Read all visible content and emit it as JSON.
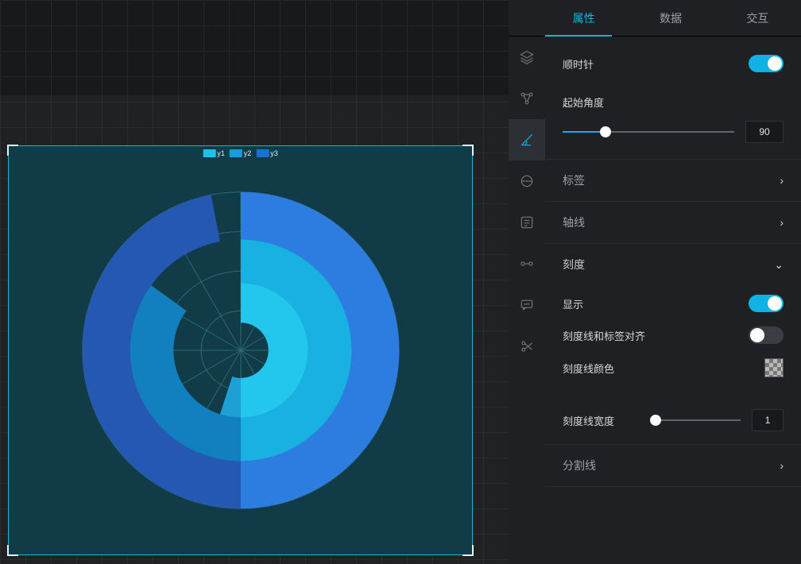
{
  "tabs": {
    "properties": "属性",
    "data": "数据",
    "interaction": "交互"
  },
  "iconbar": {
    "layers": "layers-icon",
    "nodes": "nodes-icon",
    "angle": "angle-icon",
    "circle": "circle-icon",
    "form": "form-icon",
    "link": "link-icon",
    "chat": "chat-icon",
    "scissors": "scissors-icon"
  },
  "settings": {
    "clockwise": {
      "label": "顺时针",
      "value": true
    },
    "start_angle": {
      "label": "起始角度",
      "value": 90,
      "min": 0,
      "max": 360
    },
    "labels_section": "标签",
    "axis_section": "轴线",
    "ticks_section": "刻度",
    "ticks": {
      "show": {
        "label": "显示",
        "value": true
      },
      "align": {
        "label": "刻度线和标签对齐",
        "value": false
      },
      "color": {
        "label": "刻度线颜色"
      },
      "width": {
        "label": "刻度线宽度",
        "value": 1,
        "min": 1,
        "max": 20
      }
    },
    "splitline_section": "分割线"
  },
  "chart_data": {
    "type": "polar-bar",
    "legend": [
      {
        "name": "y1",
        "color": "#1fc1ea"
      },
      {
        "name": "y2",
        "color": "#1a9cd8"
      },
      {
        "name": "y3",
        "color": "#1d6fd6"
      }
    ],
    "note": "Stacked radial bars; outer ring y3 is near-full, middle ring y2 ~0.85, inner y1 ~0.55 of circle. Clockwise, start angle 90.",
    "series": [
      {
        "name": "y1",
        "value": 0.55,
        "color_a": "#23c7ee",
        "color_b": "#1fa0d4"
      },
      {
        "name": "y2",
        "value": 0.85,
        "color_a": "#18b1e2",
        "color_b": "#127fbf"
      },
      {
        "name": "y3",
        "value": 0.97,
        "color_a": "#2d7de0",
        "color_b": "#2458b3"
      }
    ],
    "radial_ticks": 12,
    "ring_guides": 4
  }
}
